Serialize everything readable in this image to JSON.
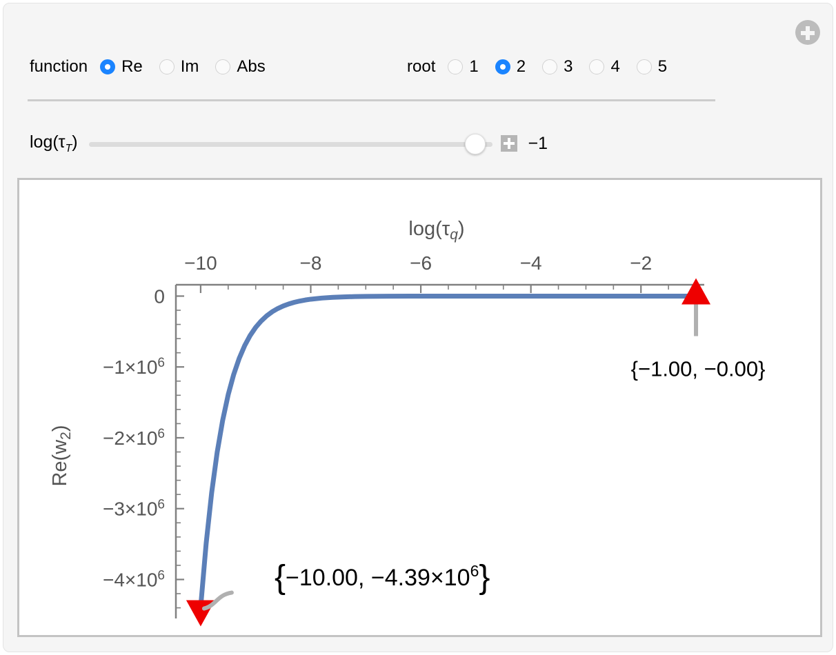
{
  "window": {
    "plus_button_icon": "plus-circle-icon"
  },
  "controls": {
    "function": {
      "label": "function",
      "options": [
        "Re",
        "Im",
        "Abs"
      ],
      "selected": "Re"
    },
    "root": {
      "label": "root",
      "options": [
        "1",
        "2",
        "3",
        "4",
        "5"
      ],
      "selected": "2"
    },
    "slider": {
      "label_text": "log(τT)",
      "label_base": "log(τ",
      "label_sub": "T",
      "label_close": ")",
      "value": "−1",
      "plus_icon": "plus-square-icon",
      "min": -10,
      "max": -1,
      "current": -1
    }
  },
  "chart_data": {
    "type": "line",
    "title": "",
    "xlabel": "log(τq)",
    "xlabel_base": "log(τ",
    "xlabel_sub": "q",
    "xlabel_close": ")",
    "ylabel": "Re(w2)",
    "ylabel_base": "Re(w",
    "ylabel_sub": "2",
    "ylabel_close": ")",
    "xlabel_position": "top",
    "ylabel_position": "left",
    "grid": false,
    "legend": false,
    "xlim": [
      -10.45,
      -0.85
    ],
    "ylim": [
      -4550000,
      160000
    ],
    "xticks": [
      -10,
      -8,
      -6,
      -4,
      -2
    ],
    "xticklabels": [
      "−10",
      "−8",
      "−6",
      "−4",
      "−2"
    ],
    "yticks": [
      0,
      -1000000,
      -2000000,
      -3000000,
      -4000000
    ],
    "yticklabels": [
      "0",
      "−1×10⁶",
      "−2×10⁶",
      "−3×10⁶",
      "−4×10⁶"
    ],
    "xminor_step": 0.5,
    "yminor_step": 200000,
    "series": [
      {
        "name": "Re(w2)",
        "color": "#5b7fb8",
        "x": [
          -10.0,
          -9.9,
          -9.8,
          -9.7,
          -9.6,
          -9.5,
          -9.4,
          -9.3,
          -9.2,
          -9.1,
          -9.0,
          -8.9,
          -8.8,
          -8.7,
          -8.6,
          -8.5,
          -8.4,
          -8.3,
          -8.2,
          -8.1,
          -8.0,
          -7.8,
          -7.6,
          -7.4,
          -7.2,
          -7.0,
          -6.6,
          -6.2,
          -5.8,
          -5.4,
          -5.0,
          -4.5,
          -4.0,
          -3.5,
          -3.0,
          -2.5,
          -2.0,
          -1.5,
          -1.0
        ],
        "y": [
          -4390000,
          -3490000,
          -2775000,
          -2205000,
          -1753000,
          -1393000,
          -1107000,
          -880000,
          -699000,
          -555000,
          -441000,
          -351000,
          -279000,
          -221000,
          -176000,
          -140000,
          -111000,
          -88000,
          -70000,
          -55500,
          -44100,
          -27900,
          -17600,
          -11100,
          -7000,
          -4410,
          -1760,
          -700,
          -279,
          -111,
          -44,
          -14,
          -4.4,
          -1.4,
          -0.44,
          -0.14,
          -0.04,
          -0.01,
          0
        ]
      }
    ],
    "markers": [
      {
        "name": "left-endpoint-marker",
        "direction": "down",
        "color": "#ee0000",
        "x": -10.0,
        "y": -4390000,
        "label": "{−10.00, −4.39×10⁶}",
        "label_main": "−10.00, −4.39×10",
        "label_exp": "6"
      },
      {
        "name": "right-endpoint-marker",
        "direction": "up",
        "color": "#ee0000",
        "x": -1.0,
        "y": 0,
        "label": "{−1.00, −0.00}"
      }
    ]
  }
}
